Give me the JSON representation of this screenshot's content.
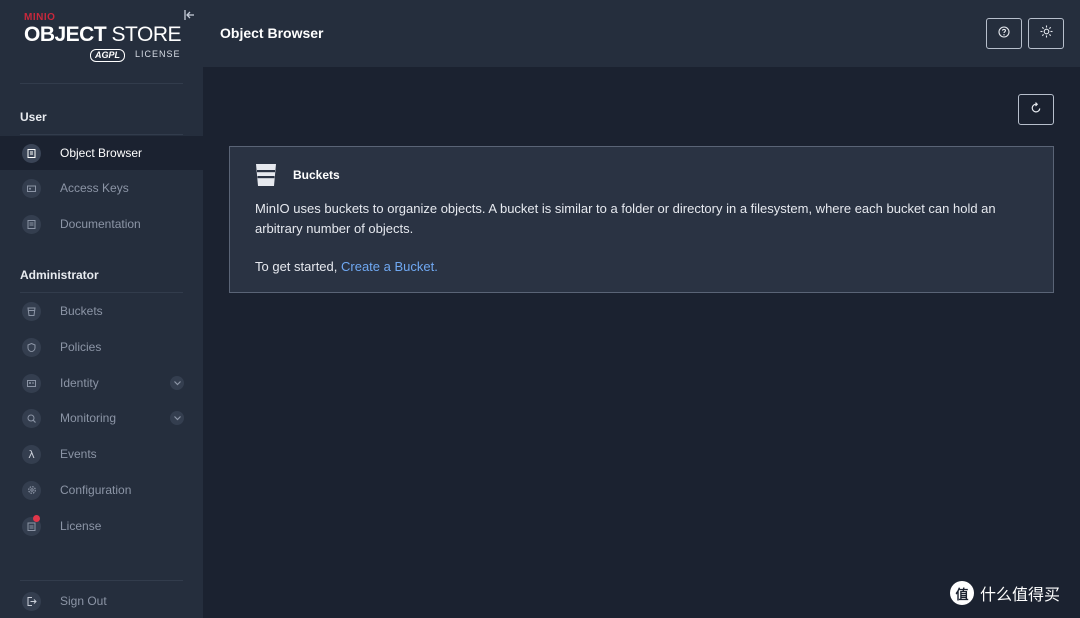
{
  "brand": {
    "minio": "MINIO",
    "store_bold": "OBJECT",
    "store_thin": "STORE",
    "agpl": "AGPL",
    "license": "LICENSE"
  },
  "sidebar": {
    "user_section": "User",
    "user_items": [
      {
        "label": "Object Browser",
        "icon": "object-browser-icon",
        "active": true
      },
      {
        "label": "Access Keys",
        "icon": "access-keys-icon"
      },
      {
        "label": "Documentation",
        "icon": "documentation-icon"
      }
    ],
    "admin_section": "Administrator",
    "admin_items": [
      {
        "label": "Buckets",
        "icon": "bucket-icon"
      },
      {
        "label": "Policies",
        "icon": "policy-icon"
      },
      {
        "label": "Identity",
        "icon": "identity-icon",
        "expandable": true
      },
      {
        "label": "Monitoring",
        "icon": "monitoring-icon",
        "expandable": true
      },
      {
        "label": "Events",
        "icon": "lambda-icon"
      },
      {
        "label": "Configuration",
        "icon": "gear-icon"
      },
      {
        "label": "License",
        "icon": "license-icon",
        "badge": true
      }
    ],
    "sign_out": "Sign Out"
  },
  "header": {
    "title": "Object Browser",
    "help_icon": "help-icon",
    "theme_icon": "sun-icon"
  },
  "main": {
    "card": {
      "title": "Buckets",
      "description": "MinIO uses buckets to organize objects. A bucket is similar to a folder or directory in a filesystem, where each bucket can hold an arbitrary number of objects.",
      "cta_prefix": "To get started, ",
      "cta_link": "Create a Bucket."
    }
  },
  "watermark": {
    "badge": "值",
    "text": "什么值得买"
  },
  "colors": {
    "sidebar_bg": "#252e3d",
    "content_bg": "#1b2230",
    "card_bg": "#2a3343",
    "link": "#6fa8f2",
    "brand_red": "#c8283c"
  }
}
